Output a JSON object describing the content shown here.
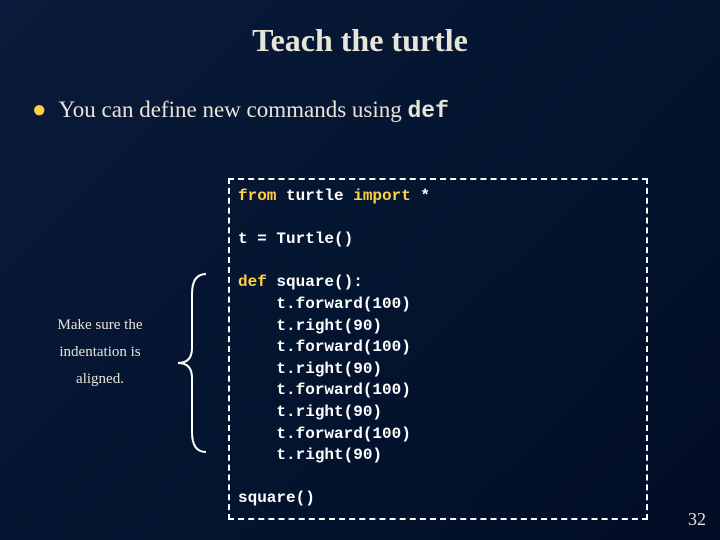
{
  "title": "Teach the turtle",
  "bullet": {
    "text_before": "You can define new commands using ",
    "keyword": "def"
  },
  "code": {
    "line1_kw1": "from",
    "line1_mid": " turtle ",
    "line1_kw2": "import",
    "line1_end": " *",
    "line2": "t = Turtle()",
    "line3_kw": "def",
    "line3_rest": " square():",
    "body": [
      "    t.forward(100)",
      "    t.right(90)",
      "    t.forward(100)",
      "    t.right(90)",
      "    t.forward(100)",
      "    t.right(90)",
      "    t.forward(100)",
      "    t.right(90)"
    ],
    "call": "square()"
  },
  "annotation": {
    "line1": "Make sure the",
    "line2": "indentation is",
    "line3": "aligned."
  },
  "page_number": "32"
}
